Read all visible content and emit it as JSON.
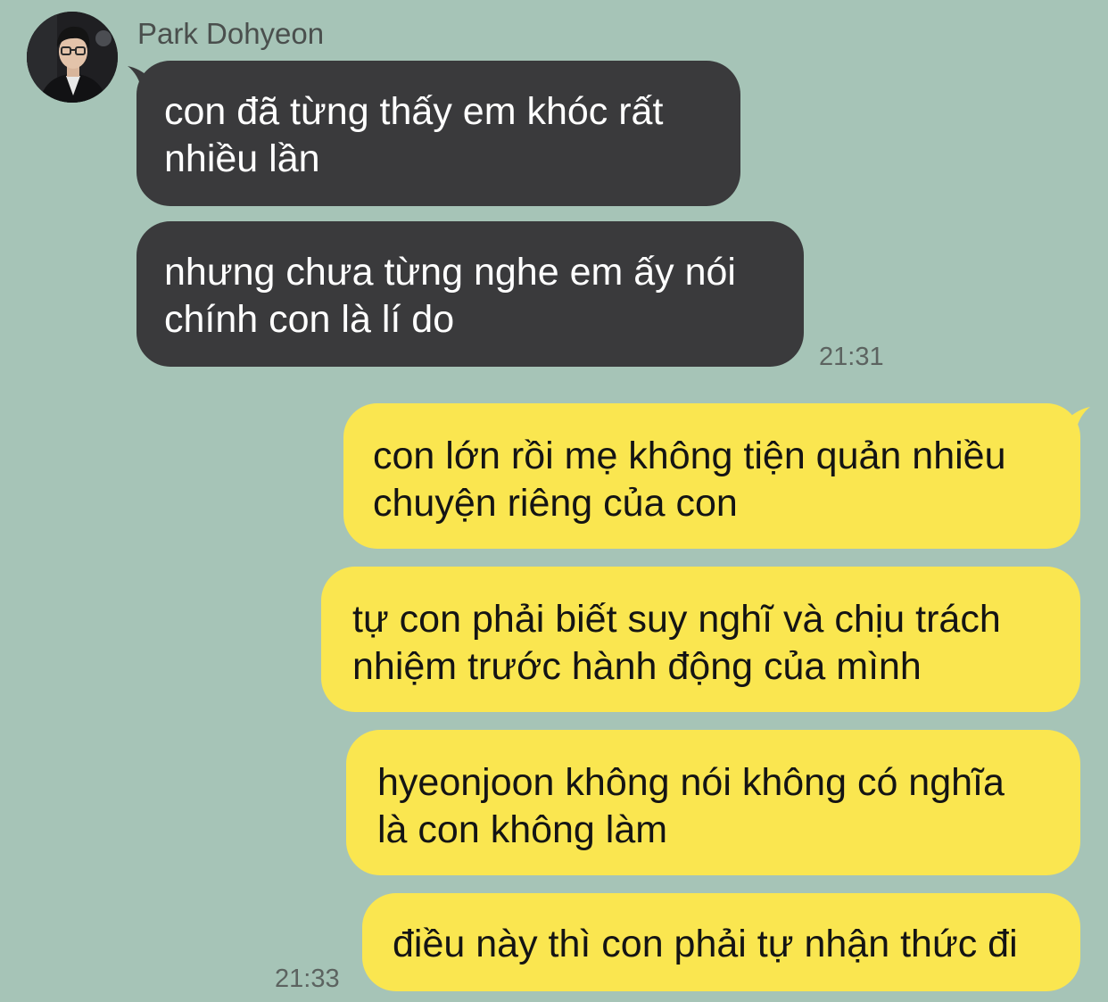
{
  "contact": {
    "name": "Park Dohyeon",
    "avatar_icon": "profile-photo"
  },
  "colors": {
    "background": "#a6c4b7",
    "incoming_bubble": "#3a3a3c",
    "outgoing_bubble": "#fae650"
  },
  "incoming": {
    "messages": [
      {
        "lines": [
          "con đã từng thấy em khóc rất",
          "nhiều lần"
        ]
      },
      {
        "lines": [
          "nhưng chưa từng nghe em ấy nói",
          "chính con là lí do"
        ]
      }
    ],
    "time": "21:31"
  },
  "outgoing": {
    "messages": [
      {
        "lines": [
          "con lớn rồi mẹ không tiện quản nhiều",
          "chuyện riêng của con"
        ]
      },
      {
        "lines": [
          "tự con phải biết suy nghĩ và chịu trách",
          "nhiệm trước hành động của mình"
        ]
      },
      {
        "lines": [
          "hyeonjoon không nói không có nghĩa",
          "là con không làm"
        ]
      },
      {
        "lines": [
          "điều này thì con phải tự nhận thức đi"
        ]
      }
    ],
    "time": "21:33"
  }
}
